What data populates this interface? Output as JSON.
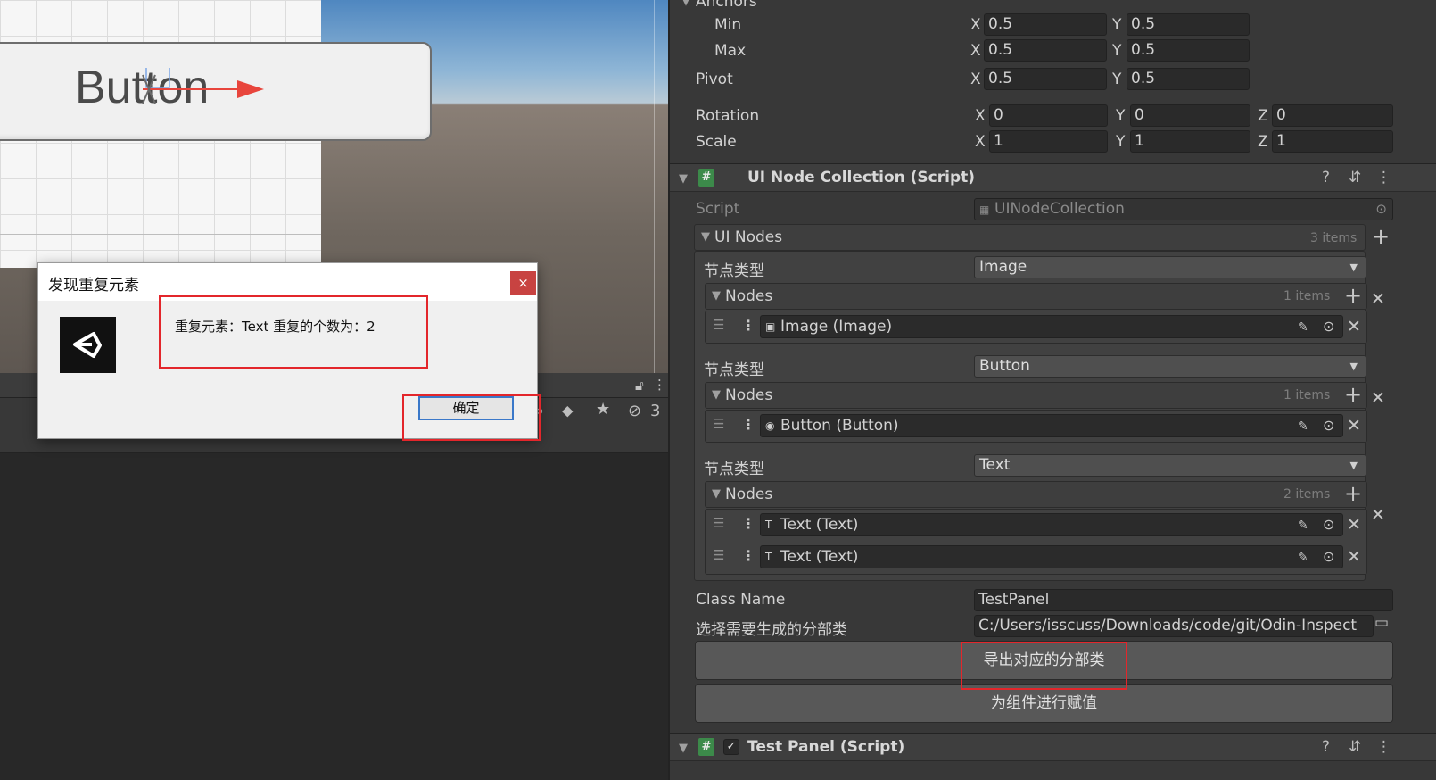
{
  "scene": {
    "button_preview_label": "Button"
  },
  "lower_panel": {
    "hidden_count": "3"
  },
  "dialog": {
    "title": "发现重复元素",
    "close_label": "×",
    "message": "重复元素：Text 重复的个数为：2",
    "ok_label": "确定"
  },
  "inspector": {
    "rect_transform": {
      "anchors_label": "Anchors",
      "min_label": "Min",
      "max_label": "Max",
      "pivot_label": "Pivot",
      "rotation_label": "Rotation",
      "scale_label": "Scale",
      "anchor_min": {
        "x_label": "X",
        "x": "0.5",
        "y_label": "Y",
        "y": "0.5"
      },
      "anchor_max": {
        "x_label": "X",
        "x": "0.5",
        "y_label": "Y",
        "y": "0.5"
      },
      "pivot": {
        "x_label": "X",
        "x": "0.5",
        "y_label": "Y",
        "y": "0.5"
      },
      "rotation": {
        "x_label": "X",
        "x": "0",
        "y_label": "Y",
        "y": "0",
        "z_label": "Z",
        "z": "0"
      },
      "scale": {
        "x_label": "X",
        "x": "1",
        "y_label": "Y",
        "y": "1",
        "z_label": "Z",
        "z": "1"
      }
    },
    "ui_node_collection": {
      "title": "UI Node Collection (Script)",
      "script_label": "Script",
      "script_value": "UINodeCollection",
      "ui_nodes_label": "UI Nodes",
      "ui_nodes_count": "3 items",
      "groups": [
        {
          "type_label": "节点类型",
          "type_value": "Image",
          "nodes_label": "Nodes",
          "count": "1 items",
          "nodes": [
            "Image (Image)"
          ]
        },
        {
          "type_label": "节点类型",
          "type_value": "Button",
          "nodes_label": "Nodes",
          "count": "1 items",
          "nodes": [
            "Button (Button)"
          ]
        },
        {
          "type_label": "节点类型",
          "type_value": "Text",
          "nodes_label": "Nodes",
          "count": "2 items",
          "nodes": [
            "Text (Text)",
            "Text (Text)"
          ]
        }
      ],
      "class_name_label": "Class Name",
      "class_name_value": "TestPanel",
      "partial_class_label": "选择需要生成的分部类",
      "partial_class_path": "C:/Users/isscuss/Downloads/code/git/Odin-Inspect",
      "export_button": "导出对应的分部类",
      "assign_button": "为组件进行赋值"
    },
    "test_panel": {
      "title": "Test Panel (Script)",
      "check": "✓"
    }
  },
  "colors": {
    "highlight_box": "#e3262b",
    "inspector_bg": "#383838",
    "field_bg": "#2a2a2a",
    "script_icon": "#3c8a4a"
  },
  "icons": [
    "lock-icon",
    "kebab-menu-icon",
    "tag-icon",
    "star-icon",
    "eye-hidden-icon",
    "help-icon",
    "preset-icon",
    "hash-script-icon",
    "plus-icon",
    "close-x-icon",
    "pencil-icon",
    "target-icon",
    "folder-icon",
    "unity-logo-icon"
  ]
}
